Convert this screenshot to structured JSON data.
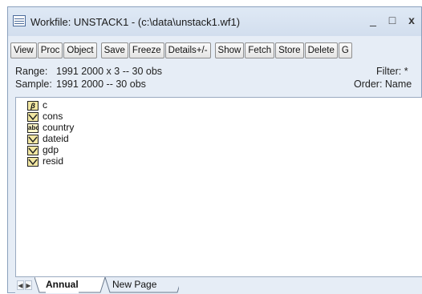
{
  "window": {
    "title": "Workfile: UNSTACK1 - (c:\\data\\unstack1.wf1)",
    "minimize_glyph": "_",
    "maximize_glyph": "□",
    "close_glyph": "x"
  },
  "toolbar": {
    "buttons": [
      "View",
      "Proc",
      "Object",
      "Save",
      "Freeze",
      "Details+/-",
      "Show",
      "Fetch",
      "Store",
      "Delete",
      "G"
    ]
  },
  "info": {
    "range_label": "Range:",
    "range_value": "1991 2000 x 3  --  30 obs",
    "filter": "Filter: *",
    "sample_label": "Sample:",
    "sample_value": "1991 2000  --  30 obs",
    "order": "Order: Name"
  },
  "objects": [
    {
      "name": "c",
      "icon": "coef-icon",
      "glyph": "β"
    },
    {
      "name": "cons",
      "icon": "series-icon"
    },
    {
      "name": "country",
      "icon": "alpha-series-icon",
      "glyph": "abc"
    },
    {
      "name": "dateid",
      "icon": "series-icon"
    },
    {
      "name": "gdp",
      "icon": "series-icon"
    },
    {
      "name": "resid",
      "icon": "series-icon"
    }
  ],
  "tabs": {
    "active": "Annual",
    "other": "New Page"
  },
  "colors": {
    "window_bg": "#e6edf6",
    "icon_fill": "#f2e7a3"
  }
}
